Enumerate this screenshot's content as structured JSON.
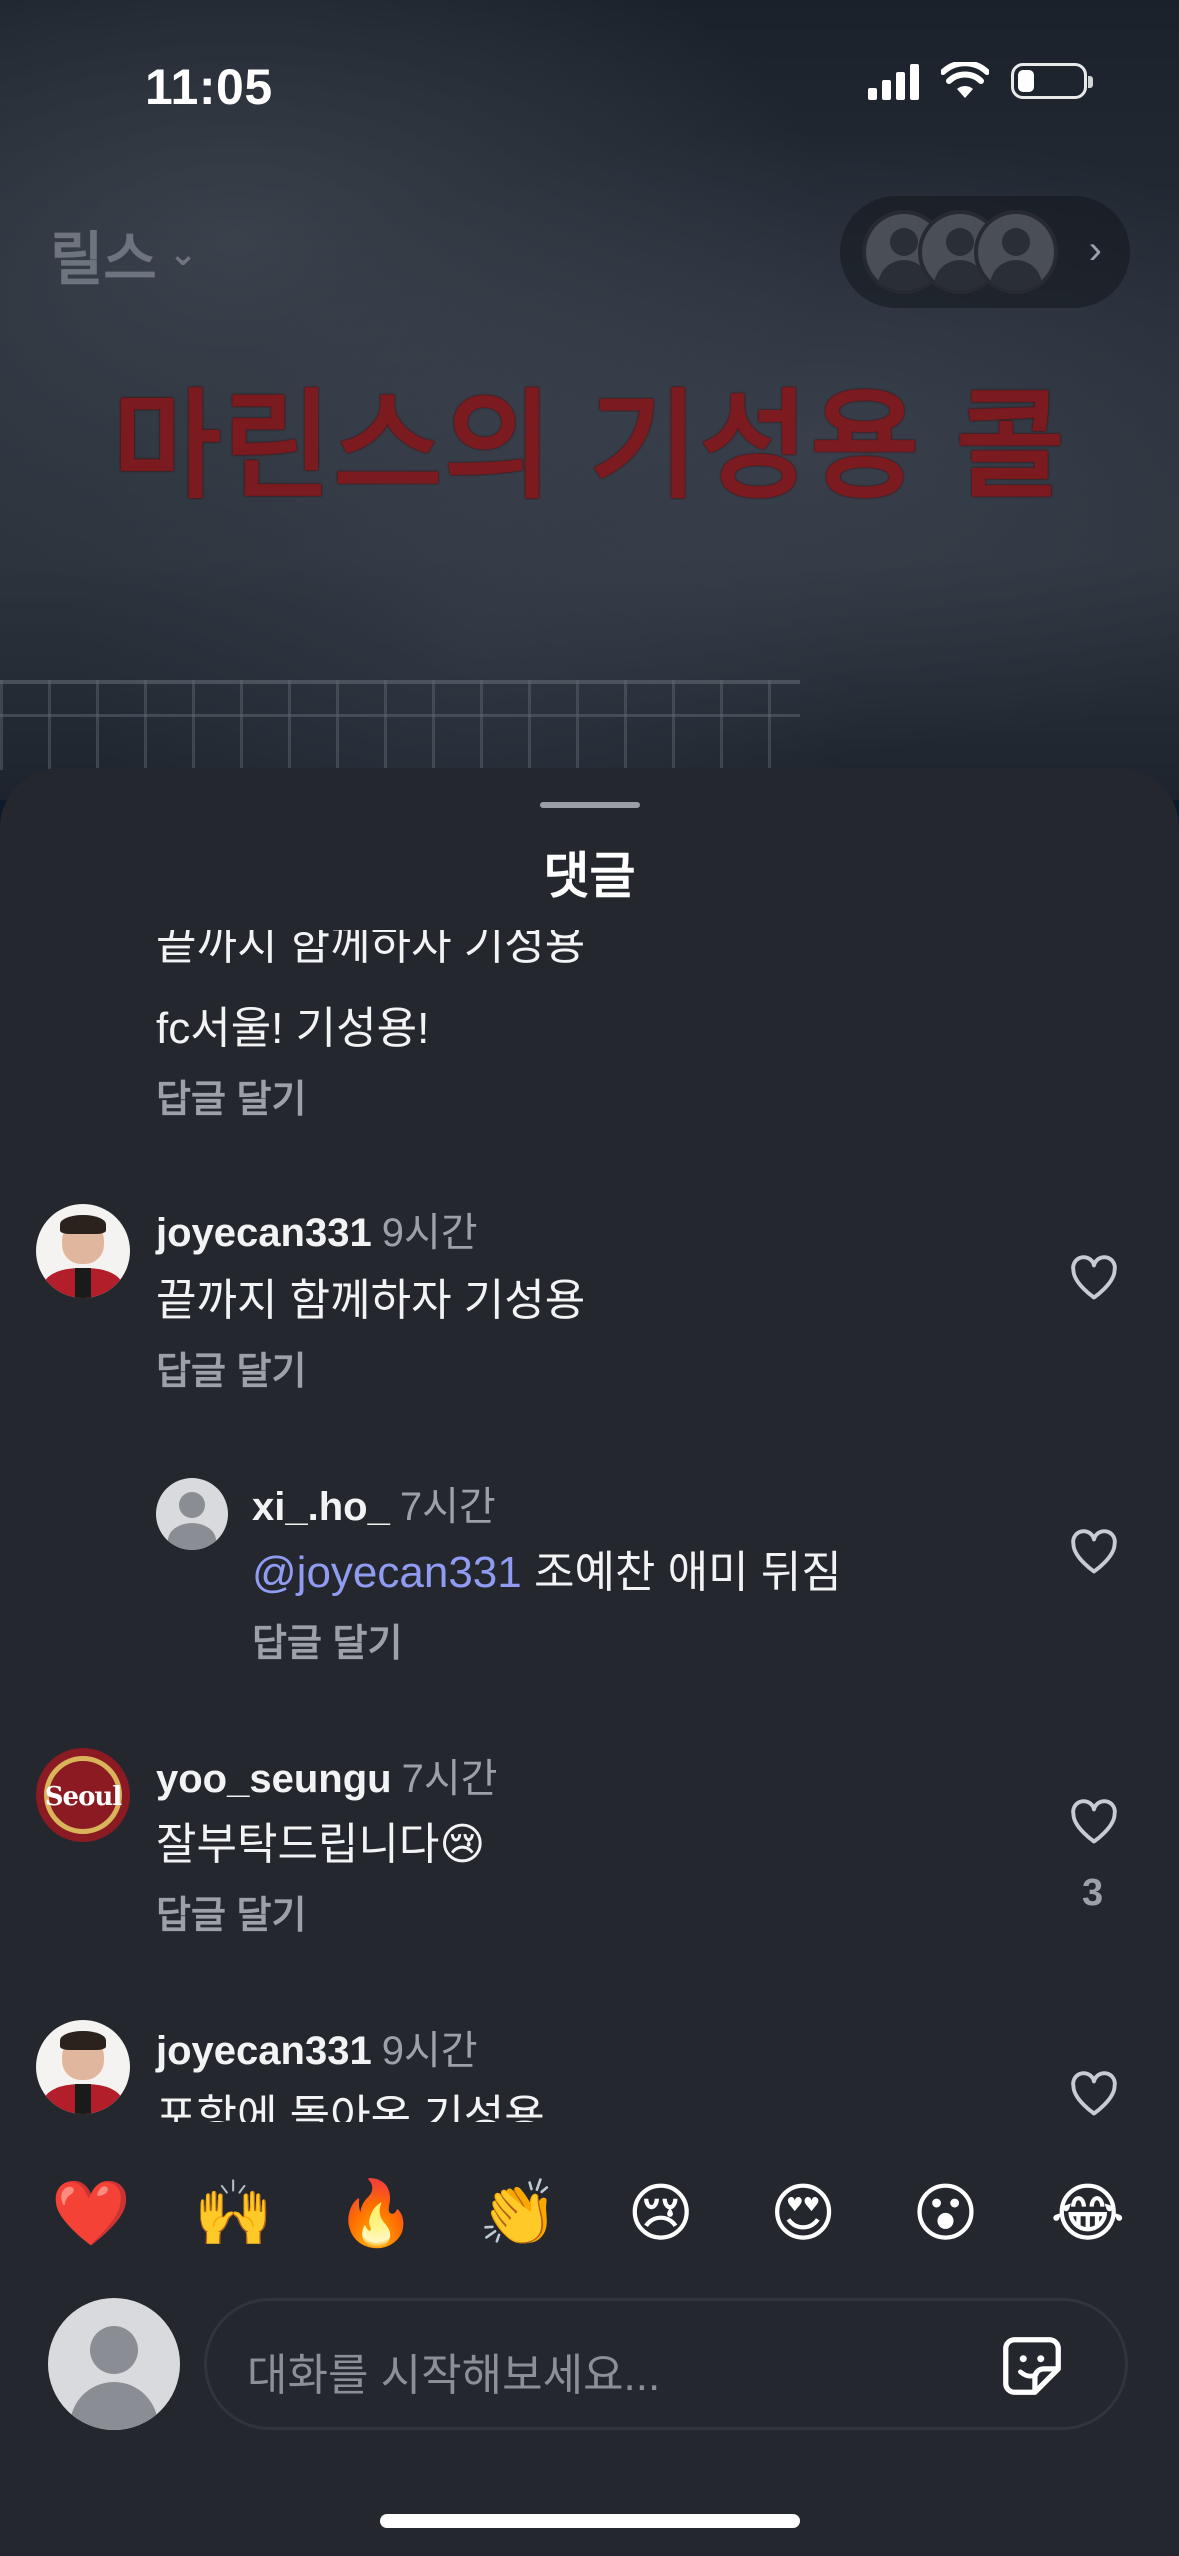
{
  "status": {
    "time": "11:05"
  },
  "header": {
    "reels_label": "릴스",
    "video_title": "마린스의 기성용 콜"
  },
  "sheet": {
    "title": "댓글"
  },
  "comments": {
    "top_partial": {
      "text_cut": "끝까지 함께하자 기성용",
      "text": "fc서울! 기성용!",
      "reply": "답글 달기"
    },
    "c1": {
      "username": "joyecan331",
      "time": "9시간",
      "text": "끝까지 함께하자 기성용",
      "reply": "답글 달기"
    },
    "c2": {
      "username": "xi_.ho_",
      "time": "7시간",
      "mention": "@joyecan331",
      "text": " 조예찬 애미 뒤짐",
      "reply": "답글 달기"
    },
    "c3": {
      "username": "yoo_seungu",
      "time": "7시간",
      "text": "잘부탁드립니다😢",
      "reply": "답글 달기",
      "likes": "3"
    },
    "c4": {
      "username": "joyecan331",
      "time": "9시간",
      "text": "포항에 돌아온 기성용"
    }
  },
  "avatar_badge": "Seoul",
  "emoji_reactions": [
    "❤️",
    "🙌",
    "🔥",
    "👏",
    "😢",
    "😍",
    "😮",
    "😂"
  ],
  "composer": {
    "placeholder": "대화를 시작해보세요..."
  },
  "colors": {
    "sheet_bg": "#24272d",
    "mention": "#8f9cf2",
    "muted": "#9ca1a9"
  }
}
